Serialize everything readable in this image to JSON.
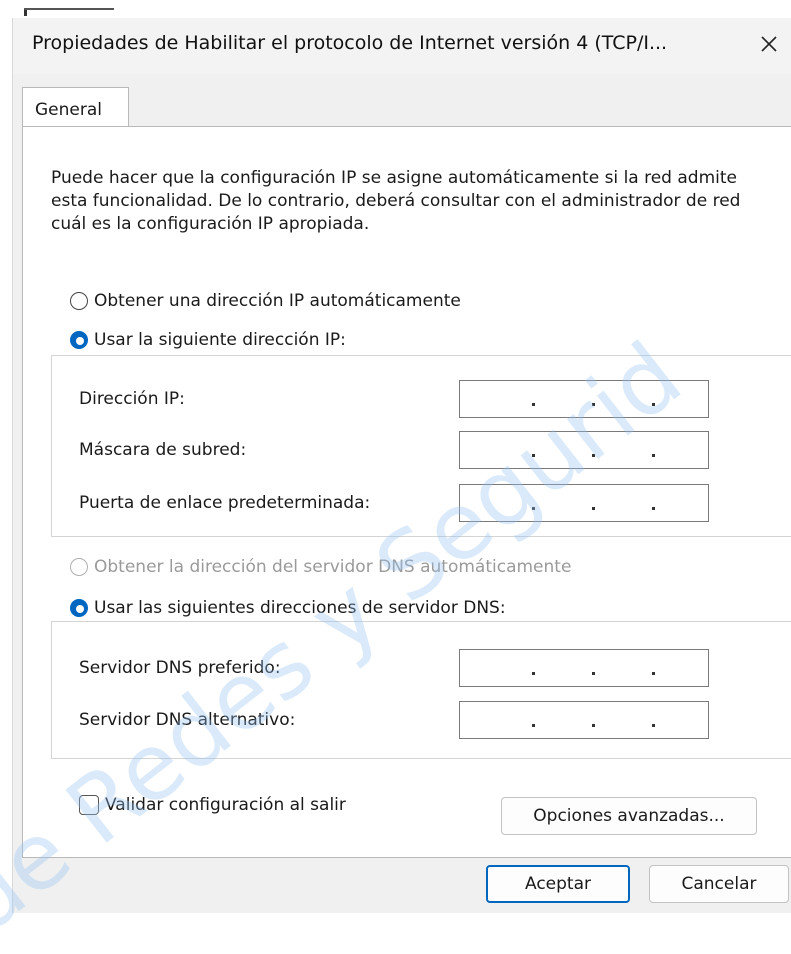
{
  "dialog": {
    "title": "Propiedades de Habilitar el protocolo de Internet versión 4 (TCP/I...",
    "close_glyph": "✕"
  },
  "tabs": [
    {
      "label": "General"
    }
  ],
  "description": "Puede hacer que la configuración IP se asigne automáticamente si la red admite esta funcionalidad. De lo contrario, deberá consultar con el administrador de red cuál es la configuración IP apropiada.",
  "ip": {
    "auto_label": "Obtener una dirección IP automáticamente",
    "manual_label": "Usar la siguiente dirección IP:",
    "selected": "manual",
    "fields": [
      {
        "label": "Dirección IP:",
        "value": ""
      },
      {
        "label": "Máscara de subred:",
        "value": ""
      },
      {
        "label": "Puerta de enlace predeterminada:",
        "value": ""
      }
    ]
  },
  "dns": {
    "auto_label": "Obtener la dirección del servidor DNS automáticamente",
    "auto_enabled": false,
    "manual_label": "Usar las siguientes direcciones de servidor DNS:",
    "selected": "manual",
    "fields": [
      {
        "label": "Servidor DNS preferido:",
        "value": ""
      },
      {
        "label": "Servidor DNS alternativo:",
        "value": ""
      }
    ]
  },
  "validate": {
    "label": "Validar configuración al salir",
    "checked": false
  },
  "buttons": {
    "advanced": "Opciones avanzadas...",
    "ok": "Aceptar",
    "cancel": "Cancelar"
  },
  "watermark": "de Redes y Segurid",
  "colors": {
    "accent": "#0067c0",
    "watermark": "#96c3f0"
  },
  "icons": {
    "close": "close-icon",
    "radio": "radio-icon",
    "checkbox": "checkbox-icon"
  }
}
